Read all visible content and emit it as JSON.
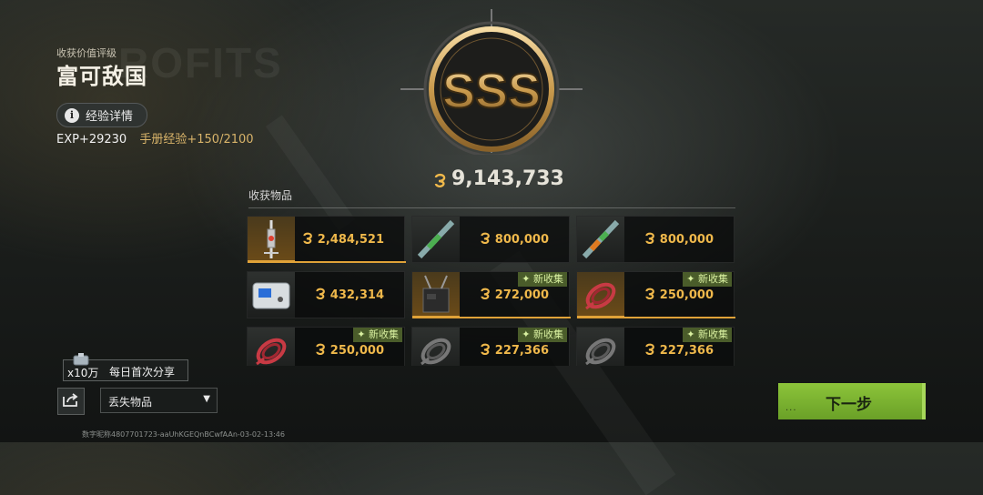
{
  "header": {
    "rating_label": "收获价值评级",
    "rating_title": "富可敌国",
    "exp_details_button": "经验详情",
    "exp_value": "EXP+29230",
    "handbook_exp": "手册经验+150/2100"
  },
  "emblem": {
    "grade": "SSS"
  },
  "total_value": "9,143,733",
  "items": {
    "title": "收获物品",
    "cards": [
      {
        "price": "2,484,521",
        "new": false,
        "highlight": true,
        "icon": "syringe-icon"
      },
      {
        "price": "800,000",
        "new": false,
        "highlight": false,
        "icon": "green-injector-icon"
      },
      {
        "price": "800,000",
        "new": false,
        "highlight": false,
        "icon": "orange-injector-icon"
      },
      {
        "price": "432,314",
        "new": false,
        "highlight": false,
        "icon": "power-station-icon"
      },
      {
        "price": "272,000",
        "new": true,
        "highlight": true,
        "icon": "radio-device-icon"
      },
      {
        "price": "250,000",
        "new": true,
        "highlight": true,
        "icon": "red-cable-icon"
      },
      {
        "price": "250,000",
        "new": true,
        "highlight": false,
        "icon": "red-cable-icon"
      },
      {
        "price": "227,366",
        "new": true,
        "highlight": false,
        "icon": "gray-cable-icon"
      },
      {
        "price": "227,366",
        "new": true,
        "highlight": false,
        "icon": "gray-cable-icon"
      }
    ],
    "new_badge": "新收集"
  },
  "share": {
    "count": "x10万",
    "label": "每日首次分享"
  },
  "dropdown": {
    "value": "丢失物品"
  },
  "footer_id": "数字昵称4807701723-aaUhKGEQnBCwfAAn-03-02-13:46",
  "next_button": {
    "label": "下一步",
    "dots": "..."
  },
  "colors": {
    "gold": "#efb84b",
    "green": "#7cb534",
    "badge": "#4a5c2a"
  }
}
